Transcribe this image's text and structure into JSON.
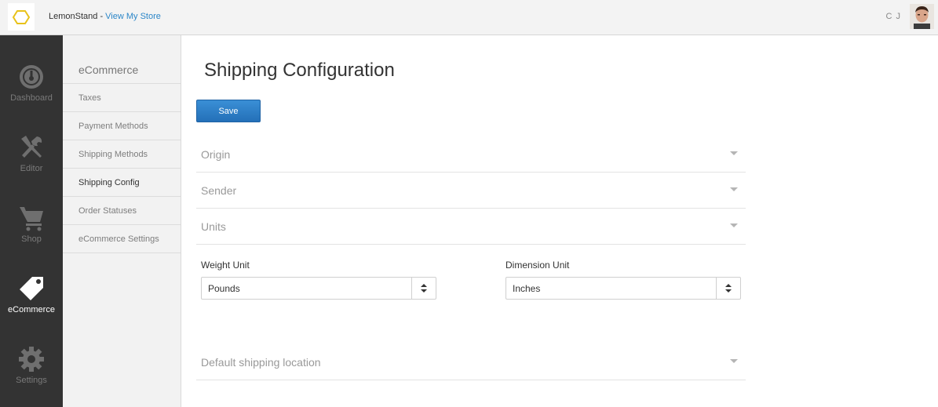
{
  "topbar": {
    "brand": "LemonStand",
    "separator": " - ",
    "store_link": "View My Store",
    "user_initials": "C J"
  },
  "rail": {
    "items": [
      {
        "label": "Dashboard",
        "icon": "dashboard-icon"
      },
      {
        "label": "Editor",
        "icon": "tools-icon"
      },
      {
        "label": "Shop",
        "icon": "cart-icon"
      },
      {
        "label": "eCommerce",
        "icon": "tag-icon",
        "active": true
      },
      {
        "label": "Settings",
        "icon": "gear-icon"
      }
    ]
  },
  "subnav": {
    "title": "eCommerce",
    "items": [
      {
        "label": "Taxes"
      },
      {
        "label": "Payment Methods"
      },
      {
        "label": "Shipping Methods"
      },
      {
        "label": "Shipping Config",
        "active": true
      },
      {
        "label": "Order Statuses"
      },
      {
        "label": "eCommerce Settings"
      }
    ]
  },
  "main": {
    "title": "Shipping Configuration",
    "save_label": "Save",
    "sections": [
      {
        "label": "Origin"
      },
      {
        "label": "Sender"
      },
      {
        "label": "Units"
      },
      {
        "label": "Default shipping location"
      }
    ],
    "weight_unit": {
      "label": "Weight Unit",
      "value": "Pounds"
    },
    "dimension_unit": {
      "label": "Dimension Unit",
      "value": "Inches"
    }
  },
  "colors": {
    "accent": "#2b86c8",
    "rail_bg": "#333333",
    "logo": "#e8c21a"
  }
}
